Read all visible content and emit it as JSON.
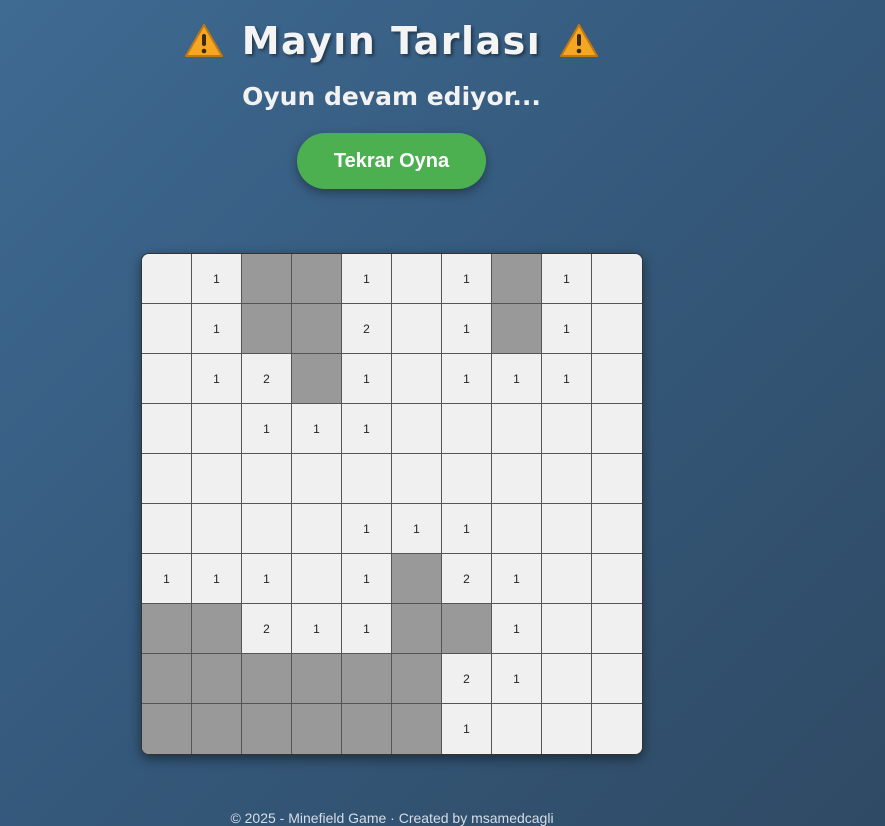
{
  "header": {
    "title": "Mayın Tarlası",
    "status": "Oyun devam ediyor...",
    "restart_label": "Tekrar Oyna"
  },
  "colors": {
    "background": "#3a6086",
    "button": "#4caf50",
    "revealed_cell": "#f0f0f0",
    "hidden_cell": "#999999",
    "warning_icon": "#f5a623"
  },
  "icons": {
    "left": "warning-icon",
    "right": "warning-icon"
  },
  "board": {
    "rows": 10,
    "cols": 10,
    "legend": "cell codes: H = hidden, '' = revealed empty, digit = revealed number",
    "cells": [
      [
        "",
        "1",
        "H",
        "H",
        "1",
        "",
        "1",
        "H",
        "1",
        ""
      ],
      [
        "",
        "1",
        "H",
        "H",
        "2",
        "",
        "1",
        "H",
        "1",
        ""
      ],
      [
        "",
        "1",
        "2",
        "H",
        "1",
        "",
        "1",
        "1",
        "1",
        ""
      ],
      [
        "",
        "",
        "1",
        "1",
        "1",
        "",
        "",
        "",
        "",
        ""
      ],
      [
        "",
        "",
        "",
        "",
        "",
        "",
        "",
        "",
        "",
        ""
      ],
      [
        "",
        "",
        "",
        "",
        "1",
        "1",
        "1",
        "",
        "",
        ""
      ],
      [
        "1",
        "1",
        "1",
        "",
        "1",
        "H",
        "2",
        "1",
        "",
        ""
      ],
      [
        "H",
        "H",
        "2",
        "1",
        "1",
        "H",
        "H",
        "1",
        "",
        ""
      ],
      [
        "H",
        "H",
        "H",
        "H",
        "H",
        "H",
        "2",
        "1",
        "",
        ""
      ],
      [
        "H",
        "H",
        "H",
        "H",
        "H",
        "H",
        "1",
        "",
        "",
        ""
      ]
    ]
  },
  "footer": {
    "text": "© 2025 - Minefield Game · Created by msamedcagli"
  }
}
